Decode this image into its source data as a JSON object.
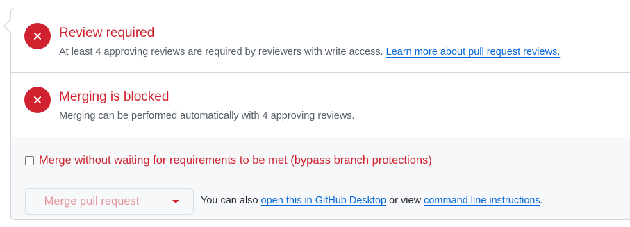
{
  "review": {
    "title": "Review required",
    "description": "At least 4 approving reviews are required by reviewers with write access.",
    "link": "Learn more about pull request reviews."
  },
  "blocked": {
    "title": "Merging is blocked",
    "description": "Merging can be performed automatically with 4 approving reviews."
  },
  "merge": {
    "bypass_label": "Merge without waiting for requirements to be met (bypass branch protections)",
    "bypass_checked": false,
    "button_label": "Merge pull request",
    "also_prefix": "You can also",
    "desktop_link": "open this in GitHub Desktop",
    "also_middle": "or view",
    "cli_link": "command line instructions",
    "also_suffix": "."
  },
  "colors": {
    "danger": "#cf222e",
    "link": "#0969da",
    "muted": "#57606a",
    "border": "#d0d7de"
  },
  "icons": {
    "status": "x-circle-icon",
    "dropdown": "triangle-down-icon"
  }
}
